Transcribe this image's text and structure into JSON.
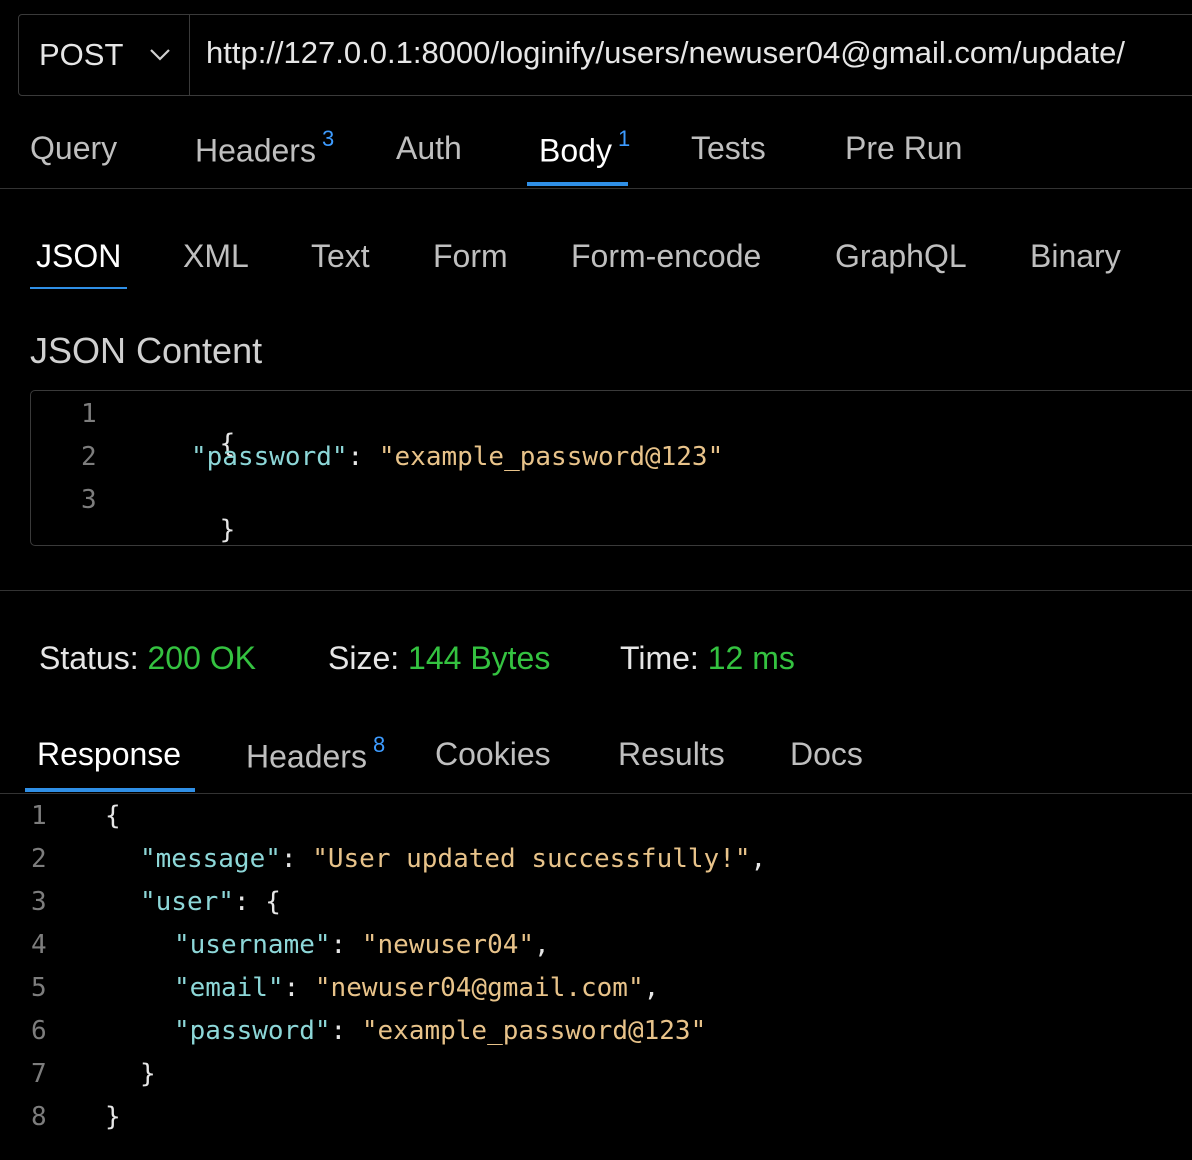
{
  "request": {
    "method": "POST",
    "url": "http://127.0.0.1:8000/loginify/users/newuser04@gmail.com/update/"
  },
  "request_tabs": [
    {
      "label": "Query",
      "badge": ""
    },
    {
      "label": "Headers",
      "badge": "3"
    },
    {
      "label": "Auth",
      "badge": ""
    },
    {
      "label": "Body",
      "badge": "1"
    },
    {
      "label": "Tests",
      "badge": ""
    },
    {
      "label": "Pre Run",
      "badge": ""
    }
  ],
  "active_request_tab": "Body",
  "body_tabs": [
    "JSON",
    "XML",
    "Text",
    "Form",
    "Form-encode",
    "GraphQL",
    "Binary"
  ],
  "active_body_tab": "JSON",
  "json_content": {
    "title": "JSON Content",
    "line_numbers": [
      "1",
      "2",
      "3"
    ],
    "open_brace": "{",
    "key": "\"password\"",
    "colon": ": ",
    "value": "\"example_password@123\"",
    "close_brace": "}"
  },
  "status": {
    "status_label": "Status:",
    "status_value": "200 OK",
    "size_label": "Size:",
    "size_value": "144 Bytes",
    "time_label": "Time:",
    "time_value": "12 ms"
  },
  "response_tabs": [
    {
      "label": "Response",
      "badge": ""
    },
    {
      "label": "Headers",
      "badge": "8"
    },
    {
      "label": "Cookies",
      "badge": ""
    },
    {
      "label": "Results",
      "badge": ""
    },
    {
      "label": "Docs",
      "badge": ""
    }
  ],
  "active_response_tab": "Response",
  "response_body": {
    "line_numbers": [
      "1",
      "2",
      "3",
      "4",
      "5",
      "6",
      "7",
      "8"
    ],
    "open_brace": "{",
    "message_key": "\"message\"",
    "message_value": "\"User updated successfully!\"",
    "user_key": "\"user\"",
    "username_key": "\"username\"",
    "username_value": "\"newuser04\"",
    "email_key": "\"email\"",
    "email_value": "\"newuser04@gmail.com\"",
    "password_key": "\"password\"",
    "password_value": "\"example_password@123\"",
    "close_inner": "}",
    "close_outer": "}"
  },
  "colors": {
    "accent": "#2f8fe6",
    "badge": "#3d9bff",
    "success": "#34c240",
    "json_key": "#8dd7d8",
    "json_string": "#e8c38a"
  },
  "icons": {
    "method_dropdown": "chevron-down-icon"
  }
}
